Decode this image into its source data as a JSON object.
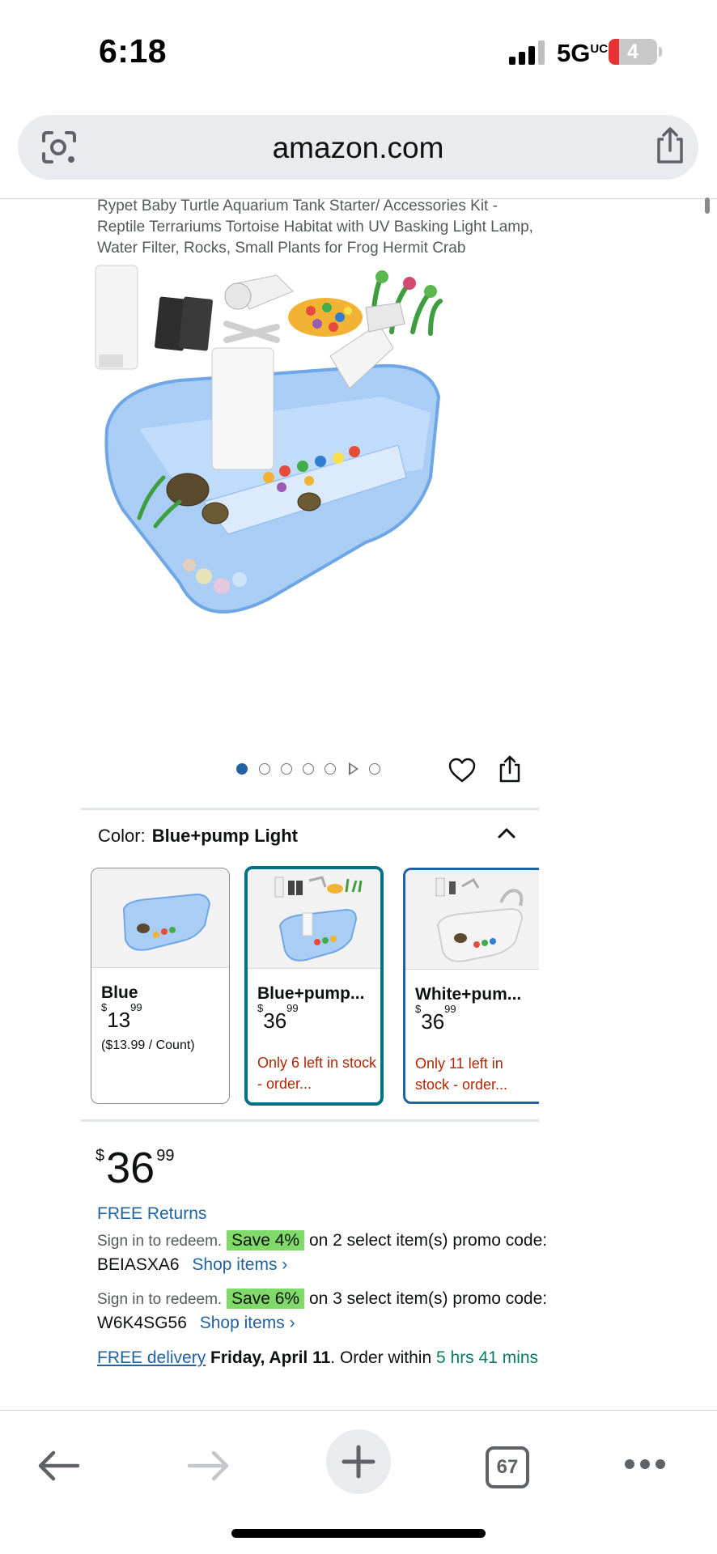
{
  "status_bar": {
    "time": "6:18",
    "network": "5G",
    "battery": "4"
  },
  "browser": {
    "url": "amazon.com",
    "tab_count": "67",
    "icons": [
      "lens-icon",
      "share-icon",
      "back-icon",
      "forward-icon",
      "plus-icon",
      "more-icon"
    ]
  },
  "product": {
    "title": "Rypet Baby Turtle Aquarium Tank Starter/ Accessories Kit - Reptile Terrariums Tortoise Habitat with UV Basking Light Lamp, Water Filter, Rocks, Small Plants for Frog Hermit Crab",
    "color_label": "Color:",
    "color_value": "Blue+pump Light",
    "variants": [
      {
        "name": "Blue",
        "price_whole": "13",
        "price_cents": "99",
        "unit": "($13.99 / Count)",
        "stock": ""
      },
      {
        "name": "Blue+pump...",
        "price_whole": "36",
        "price_cents": "99",
        "unit": "",
        "stock": "Only 6 left in stock - order..."
      },
      {
        "name": "White+pum...",
        "price_whole": "36",
        "price_cents": "99",
        "unit": "",
        "stock": "Only 11 left in stock - order..."
      }
    ],
    "price": {
      "currency": "$",
      "whole": "36",
      "cents": "99"
    },
    "free_returns": "FREE Returns",
    "promos": [
      {
        "sign_in": "Sign in to redeem.",
        "badge": "Save 4%",
        "text": "on 2 select item(s) promo code: BEIASXA6",
        "link": "Shop items ›"
      },
      {
        "sign_in": "Sign in to redeem.",
        "badge": "Save 6%",
        "text": "on 3 select item(s) promo code: W6K4SG56",
        "link": "Shop items ›"
      }
    ],
    "delivery": {
      "link": "FREE delivery",
      "date": "Friday, April 11",
      "suffix": ". Order within",
      "countdown": "5 hrs 41 mins"
    }
  },
  "colors": {
    "link": "#2162a1",
    "selected_border": "#007185",
    "promo_badge": "#7fda69",
    "stock_warning": "#b12704",
    "countdown": "#067d62"
  }
}
